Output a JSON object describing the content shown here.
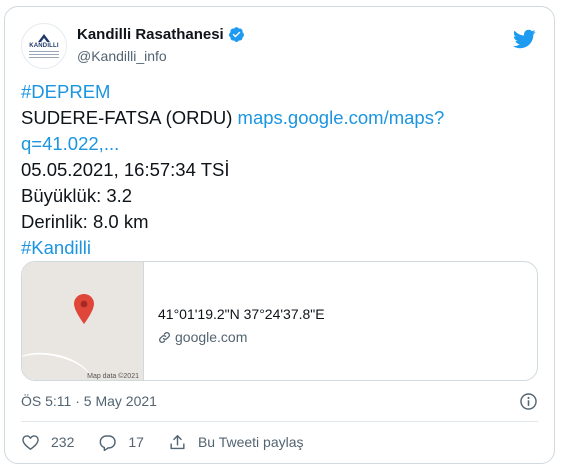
{
  "author": {
    "display_name": "Kandilli Rasathanesi",
    "handle": "@Kandilli_info",
    "avatar_text": "KANDILLI"
  },
  "tweet": {
    "hashtag1": "#DEPREM",
    "location": "SUDERE-FATSA (ORDU) ",
    "map_link_part1": "maps.google.com/maps?",
    "map_link_part2": "q=41.022,...",
    "datetime": "05.05.2021, 16:57:34 TSİ",
    "magnitude": "Büyüklük: 3.2",
    "depth": "Derinlik: 8.0 km",
    "hashtag2": "#Kandilli"
  },
  "card": {
    "coordinates": "41°01'19.2\"N 37°24'37.8\"E",
    "domain": "google.com",
    "map_credit": "Map data ©2021"
  },
  "timestamp": "ÖS 5:11 · 5 May 2021",
  "actions": {
    "likes": "232",
    "replies": "17",
    "share_label": "Bu Tweeti paylaş"
  },
  "colors": {
    "link": "#1b95e0",
    "twitter_blue": "#1d9bf0",
    "pin_red": "#e0453a",
    "muted": "#536471"
  },
  "icons": [
    "verified-icon",
    "twitter-icon",
    "map-pin-icon",
    "link-icon",
    "info-icon",
    "heart-icon",
    "reply-icon",
    "share-icon"
  ]
}
